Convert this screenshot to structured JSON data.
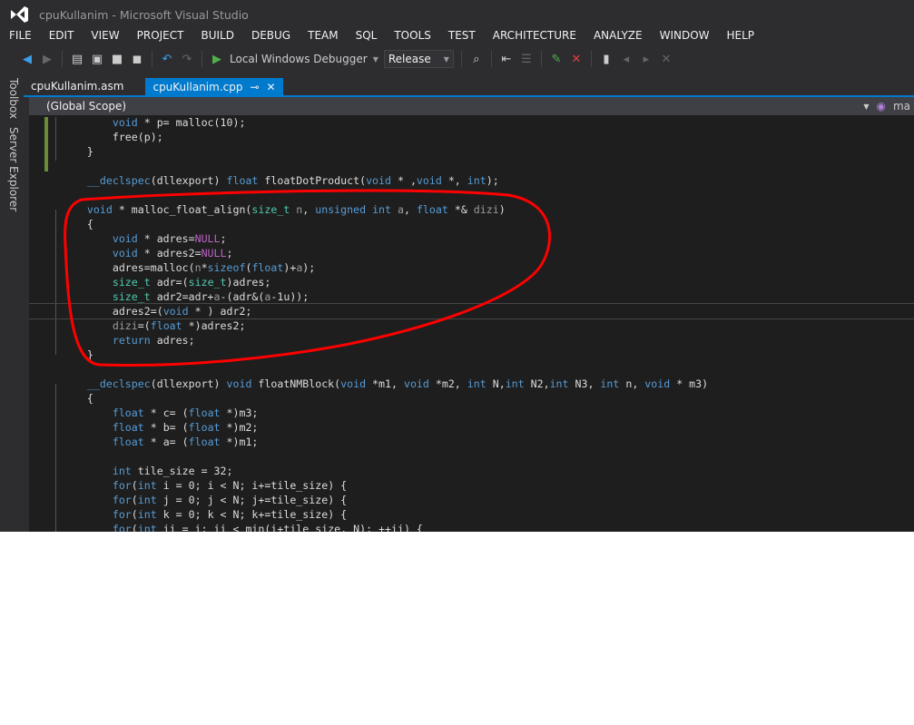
{
  "window": {
    "title": "cpuKullanim - Microsoft Visual Studio"
  },
  "menu": [
    "FILE",
    "EDIT",
    "VIEW",
    "PROJECT",
    "BUILD",
    "DEBUG",
    "TEAM",
    "SQL",
    "TOOLS",
    "TEST",
    "ARCHITECTURE",
    "ANALYZE",
    "WINDOW",
    "HELP"
  ],
  "toolbar": {
    "debugger": "Local Windows Debugger",
    "config": "Release"
  },
  "side_tabs": [
    "Toolbox",
    "Server Explorer"
  ],
  "tabs": [
    {
      "label": "cpuKullanim.asm"
    },
    {
      "label": "cpuKullanim.cpp",
      "active": true
    }
  ],
  "scope": {
    "left": "(Global Scope)",
    "right": "ma"
  },
  "annotation_color": "#ff0000",
  "code": [
    [
      [
        "        "
      ],
      [
        "void",
        "k"
      ],
      [
        " * p= malloc(10);"
      ]
    ],
    [
      [
        "        free(p);"
      ]
    ],
    [
      [
        "    }"
      ]
    ],
    [
      [
        ""
      ]
    ],
    [
      [
        "    "
      ],
      [
        "__declspec",
        "k"
      ],
      [
        "(dllexport) "
      ],
      [
        "float",
        "k"
      ],
      [
        " floatDotProduct("
      ],
      [
        "void",
        "k"
      ],
      [
        " * ,"
      ],
      [
        "void",
        "k"
      ],
      [
        " *, "
      ],
      [
        "int",
        "k"
      ],
      [
        ");"
      ]
    ],
    [
      [
        ""
      ]
    ],
    [
      [
        "    "
      ],
      [
        "void",
        "k"
      ],
      [
        " * malloc_float_align("
      ],
      [
        "size_t",
        "t"
      ],
      [
        " "
      ],
      [
        "n",
        "p"
      ],
      [
        ", "
      ],
      [
        "unsigned",
        "k"
      ],
      [
        " "
      ],
      [
        "int",
        "k"
      ],
      [
        " "
      ],
      [
        "a",
        "p"
      ],
      [
        ", "
      ],
      [
        "float",
        "k"
      ],
      [
        " *& "
      ],
      [
        "dizi",
        "p"
      ],
      [
        ")"
      ]
    ],
    [
      [
        "    {"
      ]
    ],
    [
      [
        "        "
      ],
      [
        "void",
        "k"
      ],
      [
        " * adres="
      ],
      [
        "NULL",
        "m"
      ],
      [
        ";"
      ]
    ],
    [
      [
        "        "
      ],
      [
        "void",
        "k"
      ],
      [
        " * adres2="
      ],
      [
        "NULL",
        "m"
      ],
      [
        ";"
      ]
    ],
    [
      [
        "        adres=malloc("
      ],
      [
        "n",
        "p"
      ],
      [
        "*"
      ],
      [
        "sizeof",
        "k"
      ],
      [
        "("
      ],
      [
        "float",
        "k"
      ],
      [
        ")+"
      ],
      [
        "a",
        "p"
      ],
      [
        ");"
      ]
    ],
    [
      [
        "        "
      ],
      [
        "size_t",
        "t"
      ],
      [
        " adr=("
      ],
      [
        "size_t",
        "t"
      ],
      [
        ")adres;"
      ]
    ],
    [
      [
        "        "
      ],
      [
        "size_t",
        "t"
      ],
      [
        " adr2=adr+"
      ],
      [
        "a",
        "p"
      ],
      [
        "-(adr&("
      ],
      [
        "a",
        "p"
      ],
      [
        "-1u));"
      ]
    ],
    [
      [
        "        adres2=("
      ],
      [
        "void",
        "k"
      ],
      [
        " * ) adr2;"
      ]
    ],
    [
      [
        "        "
      ],
      [
        "dizi",
        "p"
      ],
      [
        "=("
      ],
      [
        "float",
        "k"
      ],
      [
        " *)adres2;"
      ]
    ],
    [
      [
        "        "
      ],
      [
        "return",
        "k"
      ],
      [
        " adres;"
      ]
    ],
    [
      [
        "    }"
      ]
    ],
    [
      [
        ""
      ]
    ],
    [
      [
        "    "
      ],
      [
        "__declspec",
        "k"
      ],
      [
        "(dllexport) "
      ],
      [
        "void",
        "k"
      ],
      [
        " floatNMBlock("
      ],
      [
        "void",
        "k"
      ],
      [
        " *m1, "
      ],
      [
        "void",
        "k"
      ],
      [
        " *m2, "
      ],
      [
        "int",
        "k"
      ],
      [
        " N,"
      ],
      [
        "int",
        "k"
      ],
      [
        " N2,"
      ],
      [
        "int",
        "k"
      ],
      [
        " N3, "
      ],
      [
        "int",
        "k"
      ],
      [
        " n, "
      ],
      [
        "void",
        "k"
      ],
      [
        " * m3)"
      ]
    ],
    [
      [
        "    {"
      ]
    ],
    [
      [
        "        "
      ],
      [
        "float",
        "k"
      ],
      [
        " * c= ("
      ],
      [
        "float",
        "k"
      ],
      [
        " *)m3;"
      ]
    ],
    [
      [
        "        "
      ],
      [
        "float",
        "k"
      ],
      [
        " * b= ("
      ],
      [
        "float",
        "k"
      ],
      [
        " *)m2;"
      ]
    ],
    [
      [
        "        "
      ],
      [
        "float",
        "k"
      ],
      [
        " * a= ("
      ],
      [
        "float",
        "k"
      ],
      [
        " *)m1;"
      ]
    ],
    [
      [
        ""
      ]
    ],
    [
      [
        "        "
      ],
      [
        "int",
        "k"
      ],
      [
        " tile_size = 32;"
      ]
    ],
    [
      [
        "        "
      ],
      [
        "for",
        "k"
      ],
      [
        "("
      ],
      [
        "int",
        "k"
      ],
      [
        " i = 0; i < N; i+=tile_size) {"
      ]
    ],
    [
      [
        "        "
      ],
      [
        "for",
        "k"
      ],
      [
        "("
      ],
      [
        "int",
        "k"
      ],
      [
        " j = 0; j < N; j+=tile_size) {"
      ]
    ],
    [
      [
        "        "
      ],
      [
        "for",
        "k"
      ],
      [
        "("
      ],
      [
        "int",
        "k"
      ],
      [
        " k = 0; k < N; k+=tile_size) {"
      ]
    ],
    [
      [
        "        "
      ],
      [
        "for",
        "k"
      ],
      [
        "("
      ],
      [
        "int",
        "k"
      ],
      [
        " ii = i; ii < min(i+tile_size, N); ++ii) {"
      ]
    ]
  ]
}
